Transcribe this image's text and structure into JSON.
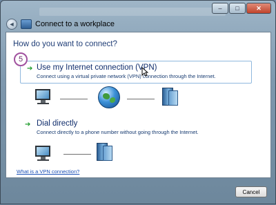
{
  "window": {
    "title": "Connect to a workplace",
    "controls": {
      "minimize": "–",
      "maximize": "□",
      "close": "✕"
    }
  },
  "page": {
    "question": "How do you want to connect?",
    "step_number": "5"
  },
  "options": [
    {
      "title": "Use my Internet connection (VPN)",
      "description": "Connect using a virtual private network (VPN) connection through the Internet.",
      "icon": "green-arrow-icon"
    },
    {
      "title": "Dial directly",
      "description": "Connect directly to a phone number without going through the Internet.",
      "icon": "green-arrow-icon"
    }
  ],
  "help_link": "What is a VPN connection?",
  "buttons": {
    "cancel": "Cancel"
  },
  "colors": {
    "heading": "#1f3d76",
    "option_title": "#0f2c6b",
    "link": "#1a4fb5",
    "highlight_border": "#8fb8de",
    "step_badge": "#a0509e"
  }
}
